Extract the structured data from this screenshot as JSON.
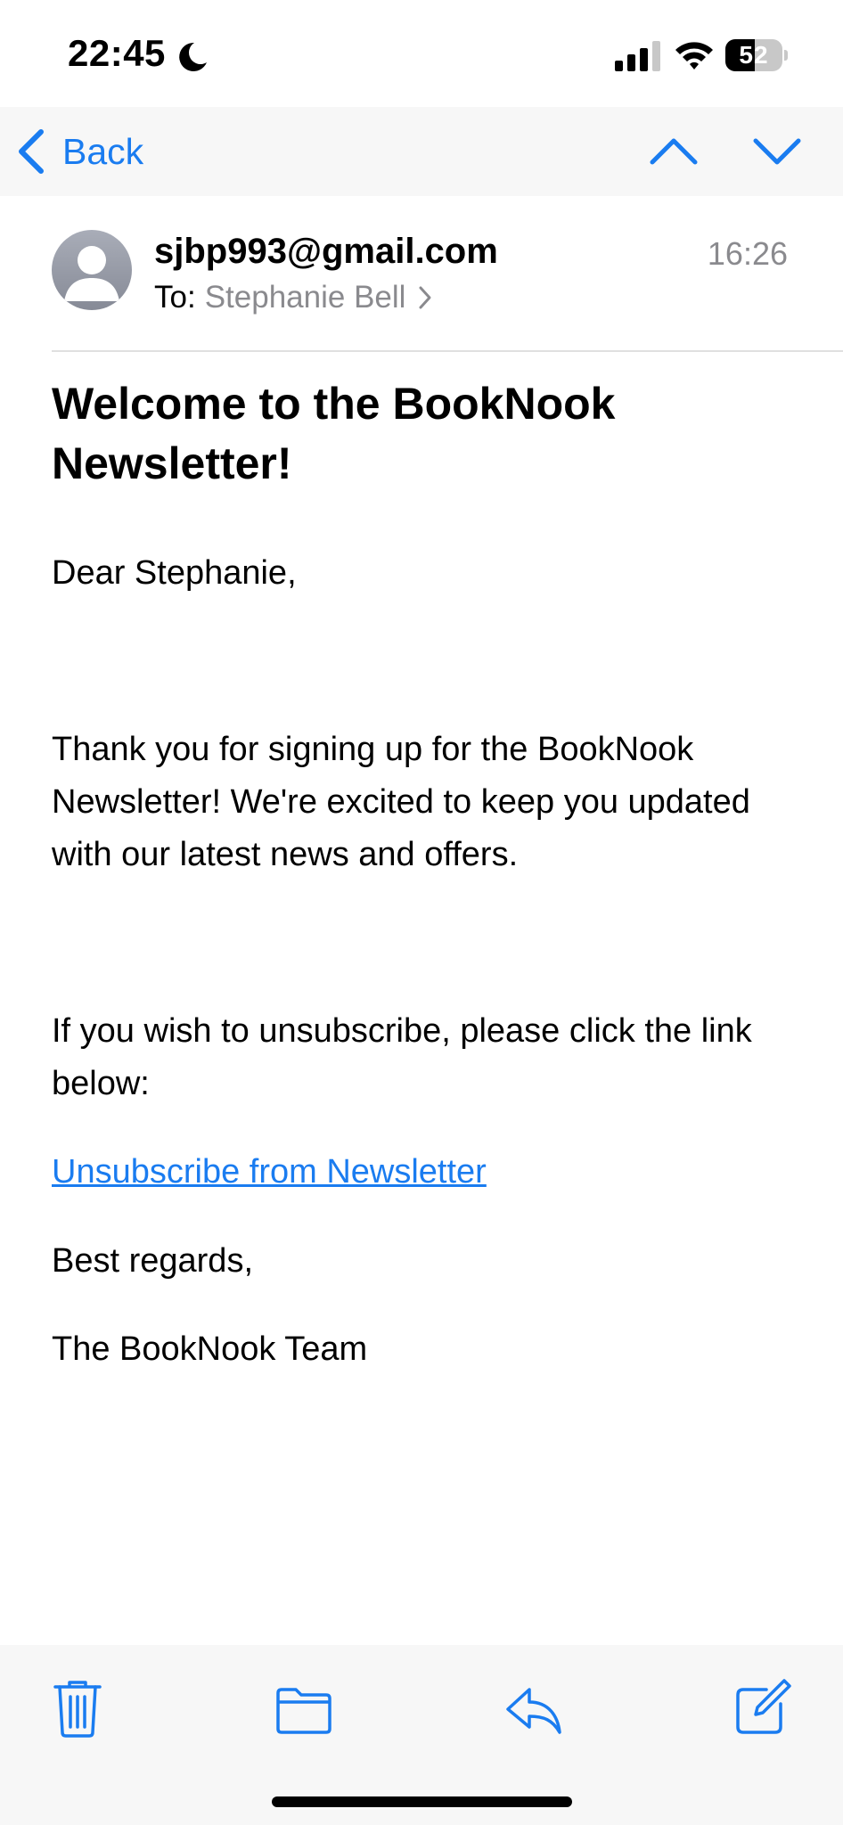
{
  "status_bar": {
    "time": "22:45",
    "battery_level": "52",
    "battery_fraction": 0.52,
    "icons": [
      "moon-icon",
      "signal-icon",
      "wifi-icon",
      "battery-icon"
    ]
  },
  "nav": {
    "back_label": "Back",
    "icons": [
      "chevron-left-icon",
      "chevron-up-icon",
      "chevron-down-icon"
    ]
  },
  "header": {
    "sender": "sjbp993@gmail.com",
    "time": "16:26",
    "to_label": "To:",
    "recipient": "Stephanie Bell"
  },
  "email": {
    "subject": "Welcome to the BookNook Newsletter!",
    "greeting": "Dear Stephanie,",
    "paragraph_1": "Thank you for signing up for the BookNook Newsletter! We're excited to keep you updated with our latest news and offers.",
    "paragraph_2": "If you wish to unsubscribe, please click the link below:",
    "unsubscribe_link": "Unsubscribe from Newsletter",
    "closing": "Best regards,",
    "signature": "The BookNook Team"
  },
  "toolbar": {
    "icons": [
      "trash-icon",
      "folder-icon",
      "reply-icon",
      "compose-icon"
    ]
  },
  "colors": {
    "accent": "#1a7cf0",
    "secondary_text": "#8a8a8e",
    "bar_background": "#f7f7f7"
  }
}
